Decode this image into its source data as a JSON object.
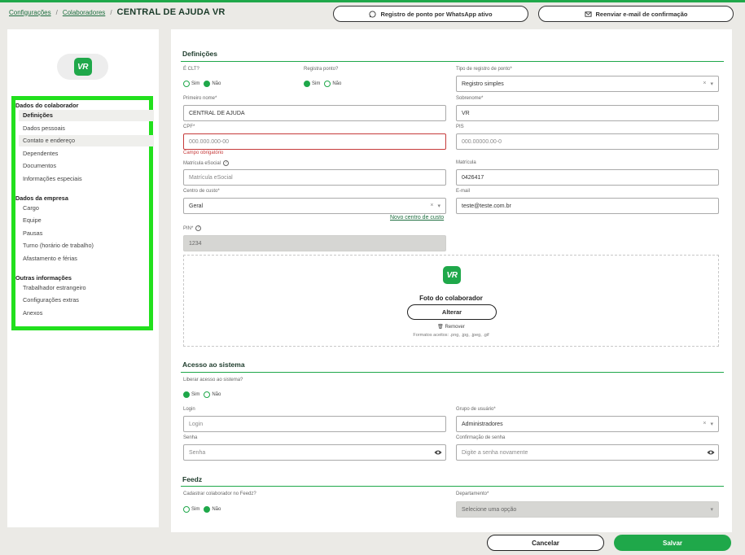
{
  "breadcrumb": {
    "item1": "Configurações",
    "sep1": "/",
    "item2": "Colaboradores",
    "sep2": "/",
    "current": "CENTRAL DE AJUDA VR"
  },
  "top_buttons": {
    "whatsapp": "Registro de ponto por WhatsApp ativo",
    "resend": "Reenviar e-mail de confirmação"
  },
  "logo_text": "VR",
  "sidebar": {
    "section1": "Dados do colaborador",
    "items1": [
      "Definições",
      "Dados pessoais",
      "Contato e endereço",
      "Dependentes",
      "Documentos",
      "Informações especiais"
    ],
    "section2": "Dados da empresa",
    "items2": [
      "Cargo",
      "Equipe",
      "Pausas",
      "Turno (horário de trabalho)",
      "Afastamento e férias"
    ],
    "section3": "Outras informações",
    "items3": [
      "Trabalhador estrangeiro",
      "Configurações extras",
      "Anexos"
    ]
  },
  "definitions": {
    "title": "Definições",
    "clt_label": "É CLT?",
    "clt_yes": "Sim",
    "clt_no": "Não",
    "punch_label": "Registra ponto?",
    "punch_yes": "Sim",
    "punch_no": "Não",
    "punch_type_label": "Tipo de registro de ponto*",
    "punch_type_value": "Registro simples",
    "first_name_label": "Primeiro nome*",
    "first_name_value": "CENTRAL DE AJUDA",
    "last_name_label": "Sobrenome*",
    "last_name_value": "VR",
    "cpf_label": "CPF*",
    "cpf_placeholder": "000.000.000-00",
    "cpf_error": "Campo obrigatório",
    "pis_label": "PIS",
    "pis_placeholder": "000.00000.00-0",
    "esocial_label": "Matrícula eSocial",
    "esocial_placeholder": "Matrícula eSocial",
    "matricula_label": "Matrícula",
    "matricula_value": "0426417",
    "cost_center_label": "Centro de custo*",
    "cost_center_value": "Geral",
    "new_cost_center": "Novo centro de custo",
    "email_label": "E-mail",
    "email_value": "teste@teste.com.br",
    "pin_label": "PIN*",
    "pin_value": "1234"
  },
  "photo": {
    "title": "Foto do colaborador",
    "change_button": "Alterar",
    "remove": "Remover",
    "formats": "Formatos aceitos: .png, .jpg, .jpeg, .gif"
  },
  "access": {
    "title": "Acesso ao sistema",
    "release_label": "Liberar acesso ao sistema?",
    "yes": "Sim",
    "no": "Não",
    "login_label": "Login",
    "login_placeholder": "Login",
    "group_label": "Grupo de usuário*",
    "group_value": "Administradores",
    "password_label": "Senha",
    "password_placeholder": "Senha",
    "confirm_label": "Confirmação de senha",
    "confirm_placeholder": "Digite a senha novamente"
  },
  "feedz": {
    "title": "Feedz",
    "register_label": "Cadastrar colaborador no Feedz?",
    "yes": "Sim",
    "no": "Não",
    "department_label": "Departamento*",
    "department_placeholder": "Selecione uma opção"
  },
  "footer": {
    "cancel": "Cancelar",
    "save": "Salvar"
  },
  "colors": {
    "accent": "#1fa84a",
    "highlight_box": "#22e01d",
    "error": "#c63b3b",
    "background": "#ebeae6"
  }
}
